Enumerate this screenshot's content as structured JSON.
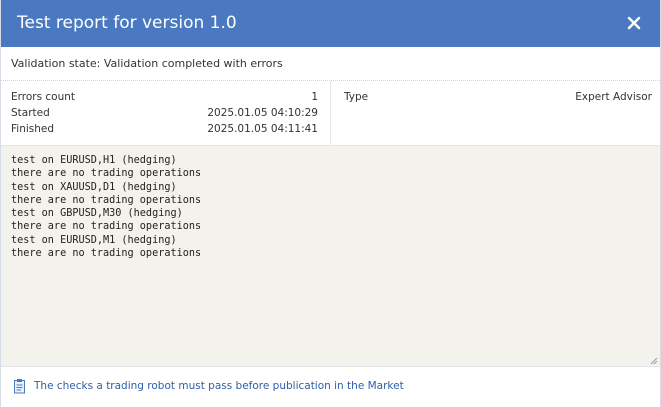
{
  "dialog": {
    "title": "Test report for version 1.0",
    "close_icon": "close-icon"
  },
  "validation": {
    "state_text": "Validation state: Validation completed with errors"
  },
  "info": {
    "errors_count_label": "Errors count",
    "errors_count_value": "1",
    "started_label": "Started",
    "started_value": "2025.01.05 04:10:29",
    "finished_label": "Finished",
    "finished_value": "2025.01.05 04:11:41",
    "type_label": "Type",
    "type_value": "Expert Advisor"
  },
  "log": {
    "lines": [
      "test on EURUSD,H1 (hedging)",
      "there are no trading operations",
      "test on XAUUSD,D1 (hedging)",
      "there are no trading operations",
      "test on GBPUSD,M30 (hedging)",
      "there are no trading operations",
      "test on EURUSD,M1 (hedging)",
      "there are no trading operations"
    ]
  },
  "footer": {
    "link_text": "The checks a trading robot must pass before publication in the Market",
    "link_icon": "document-icon"
  },
  "colors": {
    "titlebar": "#4a79c1",
    "log_background": "#f4f2ec",
    "link": "#2d5fa8"
  }
}
